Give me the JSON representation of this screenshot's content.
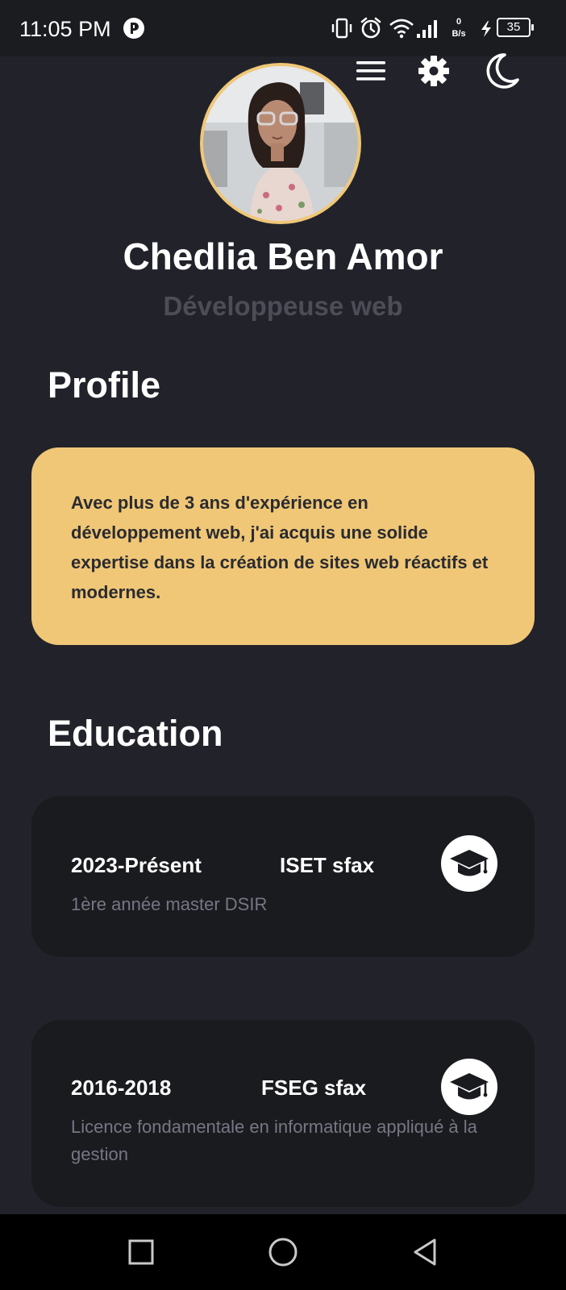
{
  "status_bar": {
    "time": "11:05 PM",
    "left_icon": "app-notification-icon",
    "icons": [
      "vibrate-icon",
      "alarm-icon",
      "wifi-icon",
      "signal-icon",
      "charging-icon"
    ],
    "net_speed_value": "0",
    "net_speed_unit": "B/s",
    "battery": "35"
  },
  "header": {
    "actions": [
      "menu-icon",
      "settings-icon",
      "dark-mode-icon"
    ]
  },
  "profile_header": {
    "name": "Chedlia Ben Amor",
    "title": "Développeuse web"
  },
  "profile": {
    "heading": "Profile",
    "text": "Avec plus de 3 ans d'expérience en développement web, j'ai acquis une solide expertise dans la création de sites web réactifs et modernes."
  },
  "education": {
    "heading": "Education",
    "items": [
      {
        "years": "2023-Présent",
        "school": "ISET sfax",
        "description": "1ère année master DSIR",
        "icon": "graduation-cap-icon"
      },
      {
        "years": "2016-2018",
        "school": "FSEG sfax",
        "description": "Licence fondamentale en informatique appliqué à la gestion",
        "icon": "graduation-cap-icon"
      }
    ]
  },
  "nav_bar": {
    "buttons": [
      "recent-apps-icon",
      "home-icon",
      "back-icon"
    ]
  },
  "colors": {
    "background": "#22232a",
    "accent": "#f0c777",
    "card_dark": "#1a1b1f",
    "muted_text": "#767784",
    "subtitle": "#4c4d56"
  }
}
